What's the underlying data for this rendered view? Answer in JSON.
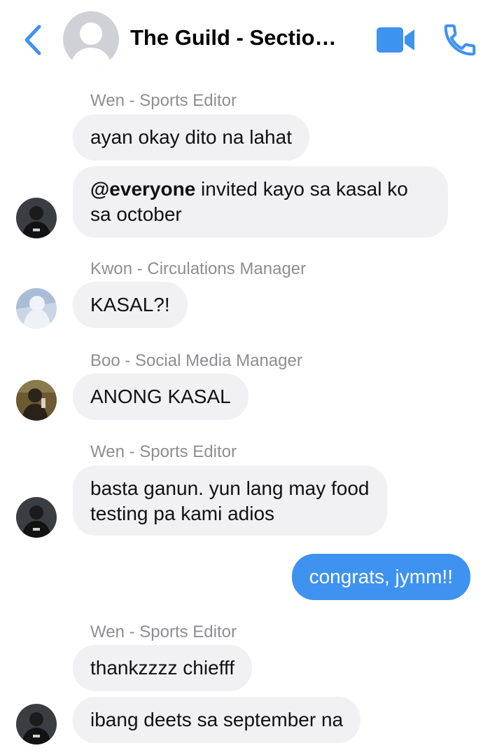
{
  "header": {
    "title": "The Guild - Sectio…",
    "back_icon": "chevron-left-icon",
    "video_icon": "video-camera-icon",
    "call_icon": "phone-icon",
    "accent": "#3e92f0"
  },
  "messages": [
    {
      "sender": "Wen - Sports Editor",
      "texts": [
        "ayan okay dito na lahat"
      ]
    },
    {
      "mention": "@everyone",
      "text_line1": " invited kayo sa kasal ko",
      "text_line2": "sa october"
    },
    {
      "sender": "Kwon - Circulations Manager",
      "texts": [
        "KASAL?!"
      ]
    },
    {
      "sender": "Boo - Social Media Manager",
      "texts": [
        "ANONG KASAL"
      ]
    },
    {
      "sender": "Wen - Sports Editor",
      "line1": "basta ganun. yun lang may food",
      "line2": "testing pa kami adios"
    },
    {
      "from_me": true,
      "text": "congrats, jymm!!"
    },
    {
      "sender": "Wen - Sports Editor",
      "texts": [
        "thankzzzz chiefff",
        "ibang deets sa september na"
      ]
    }
  ]
}
